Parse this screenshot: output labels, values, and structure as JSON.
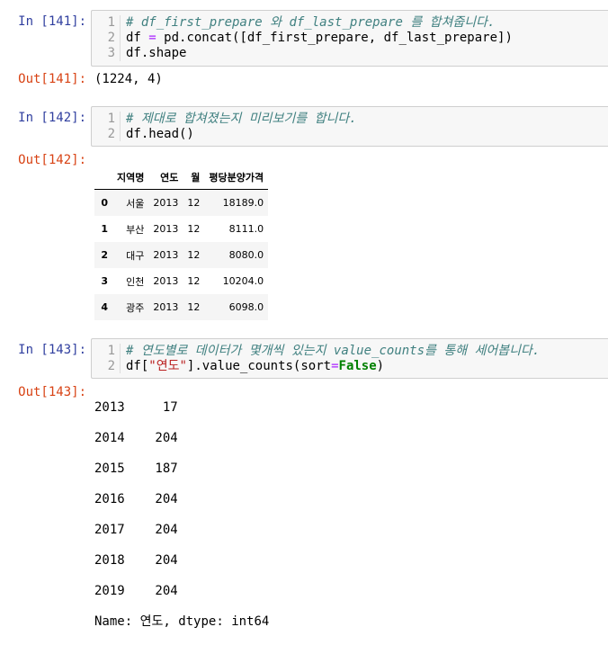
{
  "cells": [
    {
      "in_prompt": "In [141]:",
      "lines": [
        {
          "n": "1",
          "comment": "# df_first_prepare 와 df_last_prepare 를 합쳐줍니다."
        },
        {
          "n": "2",
          "a": "df ",
          "op": "=",
          "b": " pd.concat([df_first_prepare, df_last_prepare])"
        },
        {
          "n": "3",
          "a": "df.shape"
        }
      ],
      "out_prompt": "Out[141]:",
      "output": "(1224, 4)"
    },
    {
      "in_prompt": "In [142]:",
      "lines": [
        {
          "n": "1",
          "comment": "# 제대로 합쳐졌는지 미리보기를 합니다."
        },
        {
          "n": "2",
          "a": "df.head()"
        }
      ],
      "out_prompt": "Out[142]:",
      "table": {
        "columns": [
          "지역명",
          "연도",
          "월",
          "평당분양가격"
        ],
        "rows": [
          {
            "index": "0",
            "cells": [
              "서울",
              "2013",
              "12",
              "18189.0"
            ]
          },
          {
            "index": "1",
            "cells": [
              "부산",
              "2013",
              "12",
              "8111.0"
            ]
          },
          {
            "index": "2",
            "cells": [
              "대구",
              "2013",
              "12",
              "8080.0"
            ]
          },
          {
            "index": "3",
            "cells": [
              "인천",
              "2013",
              "12",
              "10204.0"
            ]
          },
          {
            "index": "4",
            "cells": [
              "광주",
              "2013",
              "12",
              "6098.0"
            ]
          }
        ]
      }
    },
    {
      "in_prompt": "In [143]:",
      "lines": [
        {
          "n": "1",
          "comment": "# 연도별로 데이터가 몇개씩 있는지 value_counts를 통해 세어봅니다."
        },
        {
          "n": "2",
          "a": "df[",
          "str": "\"연도\"",
          "b": "].value_counts(sort",
          "op": "=",
          "kw": "False",
          "c": ")"
        }
      ],
      "out_prompt": "Out[143]:",
      "output_lines": [
        "2013     17",
        "2014    204",
        "2015    187",
        "2016    204",
        "2017    204",
        "2018    204",
        "2019    204",
        "Name: 연도, dtype: int64"
      ]
    }
  ]
}
